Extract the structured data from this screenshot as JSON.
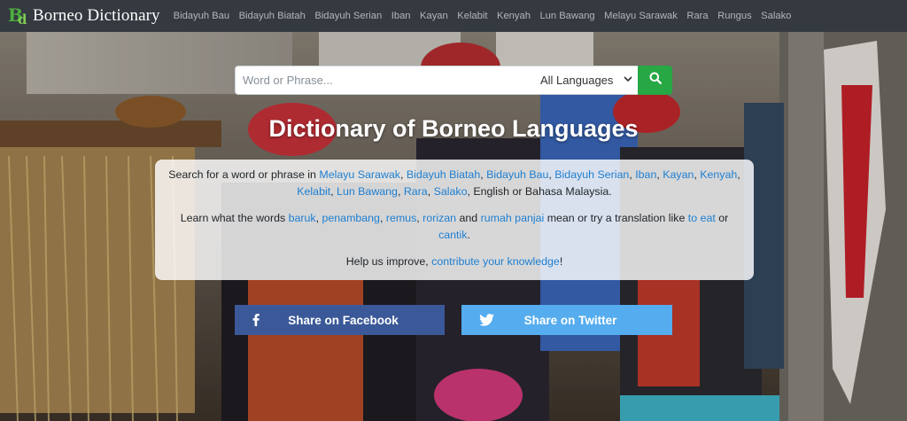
{
  "brand": {
    "logo_letters": [
      "B",
      "d"
    ],
    "name": "Borneo Dictionary",
    "logo_color": "#4cae3f"
  },
  "nav": {
    "items": [
      "Bidayuh Bau",
      "Bidayuh Biatah",
      "Bidayuh Serian",
      "Iban",
      "Kayan",
      "Kelabit",
      "Kenyah",
      "Lun Bawang",
      "Melayu Sarawak",
      "Rara",
      "Rungus",
      "Salako"
    ]
  },
  "search": {
    "placeholder": "Word or Phrase...",
    "language_selected": "All Languages",
    "button_icon": "search-icon",
    "button_color": "#28a745"
  },
  "hero": {
    "title": "Dictionary of Borneo Languages"
  },
  "info": {
    "line1_prefix": "Search for a word or phrase in",
    "languages": [
      "Melayu Sarawak",
      "Bidayuh Biatah",
      "Bidayuh Bau",
      "Bidayuh Serian",
      "Iban",
      "Kayan",
      "Kenyah",
      "Kelabit",
      "Lun Bawang",
      "Rara",
      "Salako"
    ],
    "line1_suffix": "English or Bahasa Malaysia.",
    "line2_prefix": "Learn what the words",
    "words": [
      "baruk",
      "penambang",
      "remus",
      "rorizan",
      "rumah panjai"
    ],
    "line2_middle": "mean or try a translation like",
    "translations": [
      "to eat",
      "cantik"
    ],
    "line2_or": "or",
    "line3_prefix": "Help us improve,",
    "contribute_link": "contribute your knowledge",
    "line3_suffix": "!",
    "link_color": "#1e7fd0"
  },
  "share": {
    "facebook_label": "Share on Facebook",
    "facebook_icon": "facebook-icon",
    "facebook_color": "#3b5998",
    "twitter_label": "Share on Twitter",
    "twitter_icon": "twitter-icon",
    "twitter_color": "#55acee"
  }
}
